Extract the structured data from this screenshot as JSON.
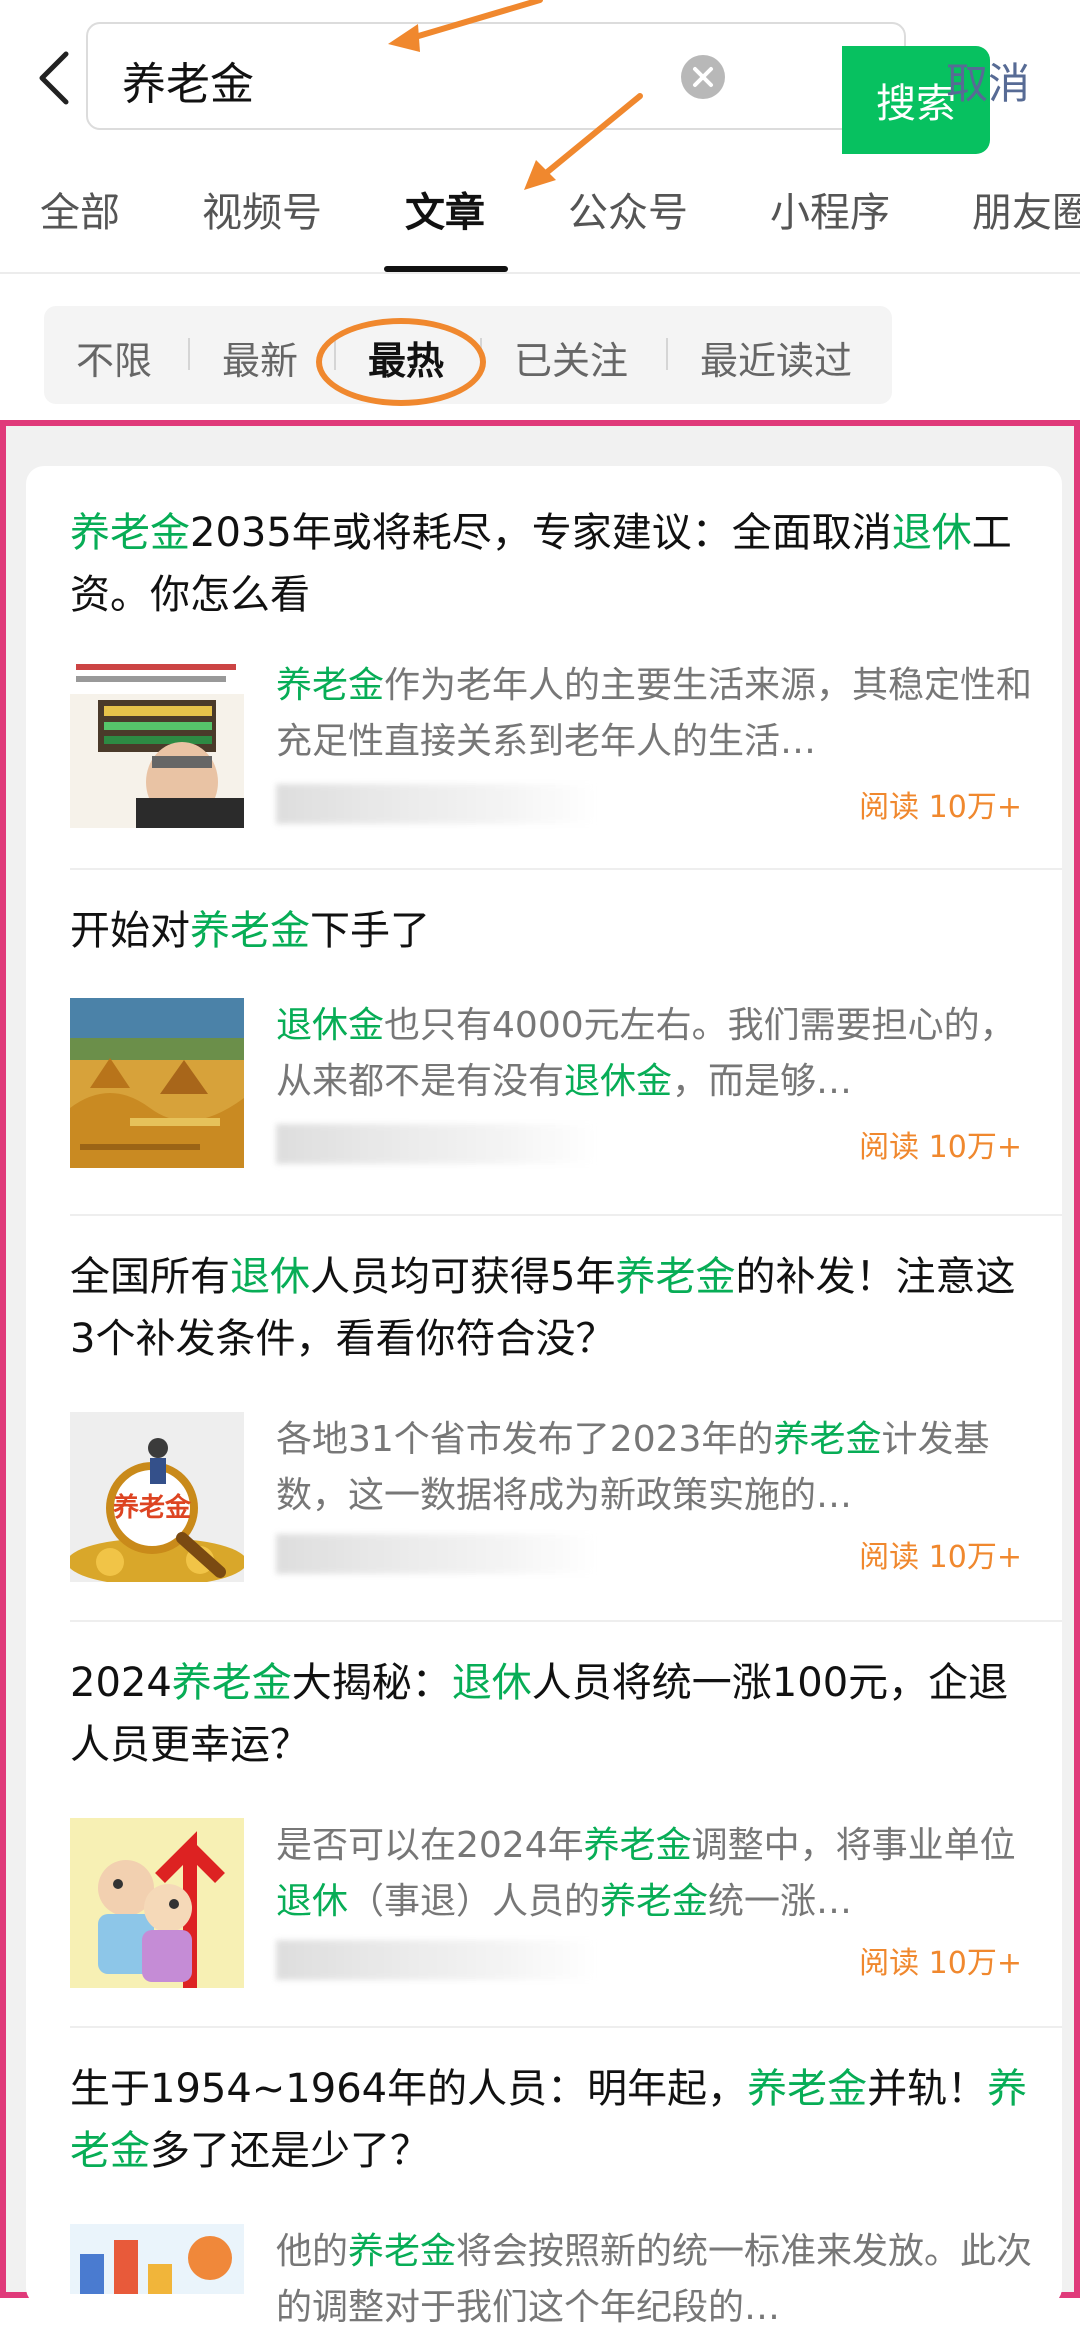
{
  "search": {
    "query": "养老金",
    "button_label": "搜索",
    "cancel_label": "取消"
  },
  "tabs": [
    {
      "label": "全部",
      "active": false
    },
    {
      "label": "视频号",
      "active": false
    },
    {
      "label": "文章",
      "active": true
    },
    {
      "label": "公众号",
      "active": false
    },
    {
      "label": "小程序",
      "active": false
    },
    {
      "label": "朋友圈",
      "active": false
    }
  ],
  "filters": [
    {
      "label": "不限",
      "active": false
    },
    {
      "label": "最新",
      "active": false
    },
    {
      "label": "最热",
      "active": true
    },
    {
      "label": "已关注",
      "active": false
    },
    {
      "label": "最近读过",
      "active": false
    }
  ],
  "colors": {
    "accent_green": "#07c160",
    "highlight_green": "#07ad56",
    "annotation_orange": "#f0882e",
    "frame_pink": "#e03a7a",
    "cancel_blue": "#576b95"
  },
  "articles": [
    {
      "title_parts": [
        {
          "text": "养老金",
          "hl": true
        },
        {
          "text": "2035年或将耗尽，专家建议：全面取消",
          "hl": false
        },
        {
          "text": "退休",
          "hl": true
        },
        {
          "text": "工资。你怎么看",
          "hl": false
        }
      ],
      "desc_parts": [
        {
          "text": "养老金",
          "hl": true
        },
        {
          "text": "作为老年人的主要生活来源，其稳定性和充足性直接关系到老年人的生活…",
          "hl": false
        }
      ],
      "read": "阅读 10万+",
      "thumb": "portrait-news-icon"
    },
    {
      "title_parts": [
        {
          "text": "开始对",
          "hl": false
        },
        {
          "text": "养老金",
          "hl": true
        },
        {
          "text": "下手了",
          "hl": false
        }
      ],
      "desc_parts": [
        {
          "text": "退休金",
          "hl": true
        },
        {
          "text": "也只有4000元左右。我们需要担心的，从来都不是有没有",
          "hl": false
        },
        {
          "text": "退休金",
          "hl": true
        },
        {
          "text": "，而是够…",
          "hl": false
        }
      ],
      "read": "阅读 10万+",
      "thumb": "wheat-painting-icon"
    },
    {
      "title_parts": [
        {
          "text": "全国所有",
          "hl": false
        },
        {
          "text": "退休",
          "hl": true
        },
        {
          "text": "人员均可获得5年",
          "hl": false
        },
        {
          "text": "养老金",
          "hl": true
        },
        {
          "text": "的补发！注意这3个补发条件，看看你符合没？",
          "hl": false
        }
      ],
      "desc_parts": [
        {
          "text": "各地31个省市发布了2023年的",
          "hl": false
        },
        {
          "text": "养老金",
          "hl": true
        },
        {
          "text": "计发基数，这一数据将成为新政策实施的…",
          "hl": false
        }
      ],
      "read": "阅读 10万+",
      "thumb": "magnifier-coins-icon",
      "thumb_label": "养老金"
    },
    {
      "title_parts": [
        {
          "text": "2024",
          "hl": false
        },
        {
          "text": "养老金",
          "hl": true
        },
        {
          "text": "大揭秘：",
          "hl": false
        },
        {
          "text": "退休",
          "hl": true
        },
        {
          "text": "人员将统一涨100元，企退人员更幸运？",
          "hl": false
        }
      ],
      "desc_parts": [
        {
          "text": "是否可以在2024年",
          "hl": false
        },
        {
          "text": "养老金",
          "hl": true
        },
        {
          "text": "调整中，将事业单位",
          "hl": false
        },
        {
          "text": "退休",
          "hl": true
        },
        {
          "text": "（事退）人员的",
          "hl": false
        },
        {
          "text": "养老金",
          "hl": true
        },
        {
          "text": "统一涨…",
          "hl": false
        }
      ],
      "read": "阅读 10万+",
      "thumb": "elderly-couple-icon"
    },
    {
      "title_parts": [
        {
          "text": "生于1954~1964年的人员：明年起，",
          "hl": false
        },
        {
          "text": "养老金",
          "hl": true
        },
        {
          "text": "并轨！",
          "hl": false
        },
        {
          "text": "养老金",
          "hl": true
        },
        {
          "text": "多了还是少了？",
          "hl": false
        }
      ],
      "desc_parts": [
        {
          "text": "他的",
          "hl": false
        },
        {
          "text": "养老金",
          "hl": true
        },
        {
          "text": "将会按照新的统一标准来发放。此次的调整对于我们这个年纪段的…",
          "hl": false
        }
      ],
      "read": "",
      "thumb": "chart-illustration-icon"
    }
  ]
}
